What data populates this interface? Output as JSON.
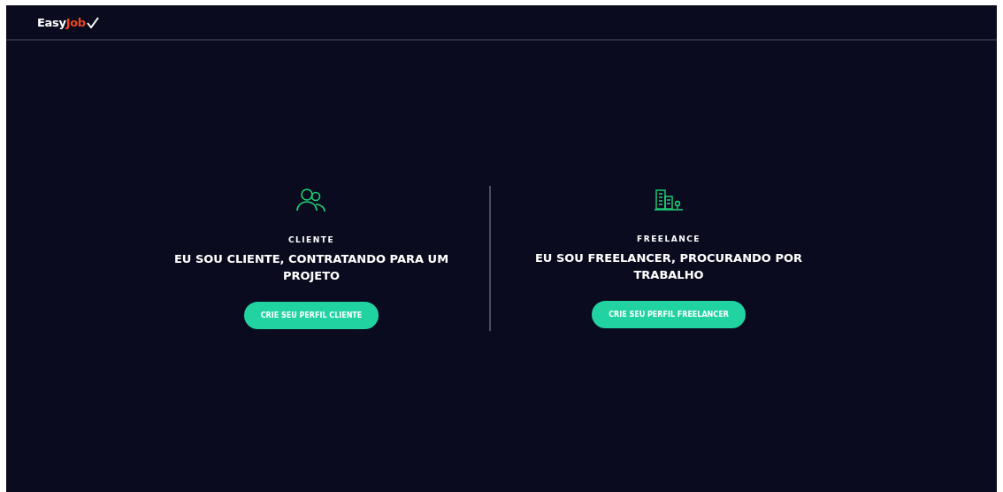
{
  "header": {
    "logo": {
      "first": "Easy",
      "second": "Job"
    }
  },
  "options": [
    {
      "kind": "people",
      "label": "CLIENTE",
      "title": "EU SOU CLIENTE, CONTRATANDO PARA UM PROJETO",
      "button": "CRIE SEU PERFIL CLIENTE"
    },
    {
      "kind": "buildings",
      "label": "FREELANCE",
      "title": "EU SOU FREELANCER, PROCURANDO POR TRABALHO",
      "button": "CRIE SEU PERFIL FREELANCER"
    }
  ]
}
